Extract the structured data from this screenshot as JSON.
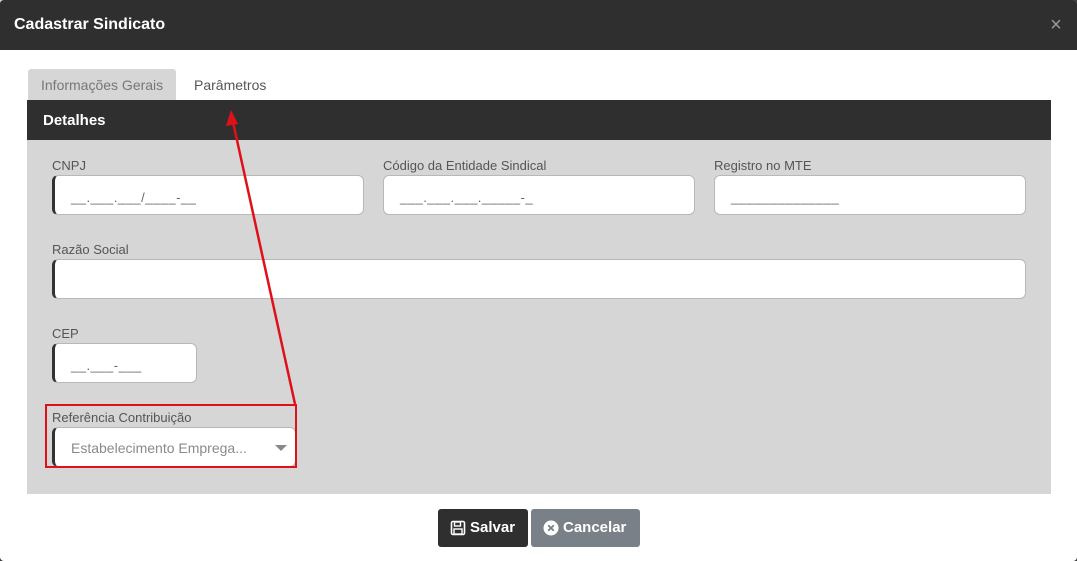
{
  "modal": {
    "title": "Cadastrar Sindicato",
    "close_symbol": "×"
  },
  "tabs": [
    {
      "label": "Informações Gerais",
      "active": true
    },
    {
      "label": "Parâmetros",
      "active": false
    }
  ],
  "panel": {
    "title": "Detalhes"
  },
  "fields": {
    "cnpj": {
      "label": "CNPJ",
      "value": "__.___.___/____-__"
    },
    "codigo": {
      "label": "Código da Entidade Sindical",
      "value": "___.___.___._____-_"
    },
    "registro": {
      "label": "Registro no MTE",
      "value": "______________"
    },
    "razao": {
      "label": "Razão Social",
      "value": ""
    },
    "cep": {
      "label": "CEP",
      "value": "__.___-___"
    },
    "referencia": {
      "label": "Referência Contribuição",
      "value": "Estabelecimento Emprega..."
    }
  },
  "buttons": {
    "save": "Salvar",
    "cancel": "Cancelar"
  },
  "icons": {
    "save": "floppy-disk-icon",
    "cancel": "x-circle-icon",
    "close": "close-icon",
    "dropdown": "caret-down-icon"
  },
  "colors": {
    "header": "#2f2f2f",
    "panel_bg": "#d6d6d6",
    "annotation": "#e0101a",
    "cancel_button": "#7a8087"
  }
}
